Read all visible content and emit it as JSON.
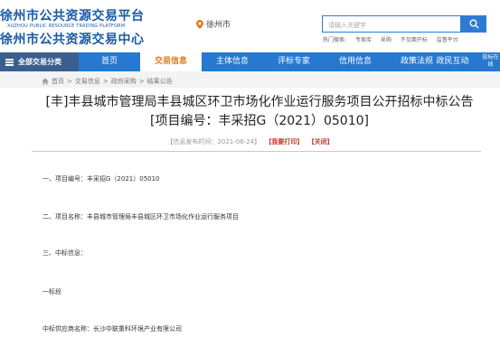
{
  "header": {
    "logo_line1": "徐州市公共资源交易平台",
    "logo_en": "XUZHOU PUBLIC RESOURCE TRADING PLATFORM",
    "logo_line2": "徐州市公共资源交易中心",
    "location": "徐州市",
    "search_placeholder": "请输入关键字",
    "hot_words": [
      "热门搜索:",
      "专家库",
      "采购",
      "不见面开标",
      "监督平台"
    ]
  },
  "nav": {
    "all_label": "全部交易分类",
    "items": [
      "首页",
      "交易信息",
      "主体信息",
      "评标专家",
      "信用信息",
      "政策法规",
      "政民互动"
    ],
    "active_index": 1,
    "extra_label": "投标在线"
  },
  "breadcrumb": [
    "首页",
    "交易信息",
    "政府采购",
    "结果公告"
  ],
  "article": {
    "title": "[丰]丰县城市管理局丰县城区环卫市场化作业运行服务项目公开招标中标公告[项目编号：丰采招G（2021）05010]",
    "date_text": "【信息发布时间：2021-06-24】",
    "print_label": "【我要打印】",
    "close_label": "【关闭】",
    "paragraphs": [
      "一、项目编号：丰采招G（2021）05010",
      "二、项目名称：丰县城市管理局丰县城区环卫市场化作业运行服务项目",
      "三、中标信息：",
      "一标段",
      "中标供应商名称：长沙中联重科环境产业有限公司"
    ]
  },
  "colors": {
    "brand_blue": "#1a5aa6",
    "nav_blue": "#2678d0",
    "active_orange": "#e07a1a",
    "meta_red": "#c0392b"
  }
}
